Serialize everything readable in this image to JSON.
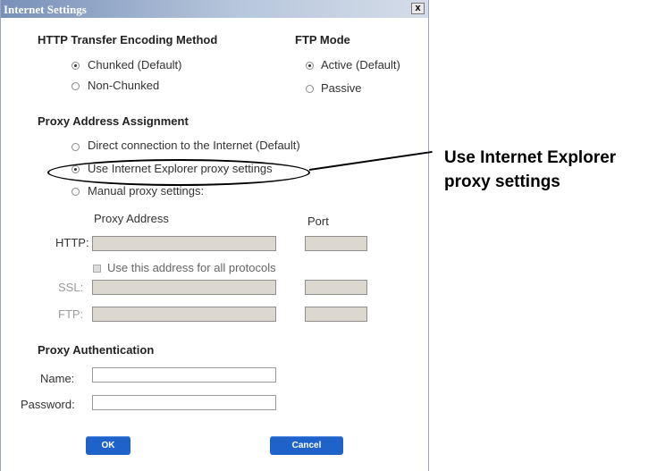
{
  "window": {
    "title": "Internet Settings",
    "close_label": "x"
  },
  "http_encoding": {
    "heading": "HTTP Transfer Encoding Method",
    "options": [
      {
        "label": "Chunked (Default)",
        "selected": true
      },
      {
        "label": "Non-Chunked",
        "selected": false
      }
    ]
  },
  "ftp_mode": {
    "heading": "FTP Mode",
    "options": [
      {
        "label": "Active (Default)",
        "selected": true
      },
      {
        "label": "Passive",
        "selected": false
      }
    ]
  },
  "proxy_assignment": {
    "heading": "Proxy Address Assignment",
    "options": [
      {
        "label": "Direct connection to the Internet  (Default)",
        "selected": false
      },
      {
        "label": "Use Internet Explorer proxy settings",
        "selected": true
      },
      {
        "label": "Manual proxy settings:",
        "selected": false
      }
    ]
  },
  "proxy_fields": {
    "address_header": "Proxy Address",
    "port_header": "Port",
    "http_label": "HTTP:",
    "same_address_label": "Use this address for all protocols",
    "ssl_label": "SSL:",
    "ftp_label": "FTP:"
  },
  "proxy_auth": {
    "heading": "Proxy Authentication",
    "name_label": "Name:",
    "password_label": "Password:"
  },
  "buttons": {
    "ok": "OK",
    "cancel": "Cancel"
  },
  "callout": {
    "line1": "Use Internet Explorer",
    "line2": "proxy settings"
  }
}
